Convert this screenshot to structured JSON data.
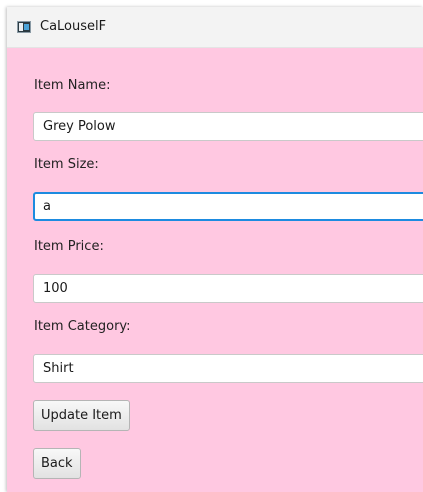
{
  "window": {
    "title": "CaLouselF",
    "icon": "java-app-icon"
  },
  "form": {
    "item_name": {
      "label": "Item Name:",
      "value": "Grey Polow"
    },
    "item_size": {
      "label": "Item Size:",
      "value": "a"
    },
    "item_price": {
      "label": "Item Price:",
      "value": "100"
    },
    "item_category": {
      "label": "Item Category:",
      "value": "Shirt"
    }
  },
  "buttons": {
    "update": "Update Item",
    "back": "Back"
  },
  "colors": {
    "background": "#ffc8e1",
    "focus": "#1d8be0"
  }
}
